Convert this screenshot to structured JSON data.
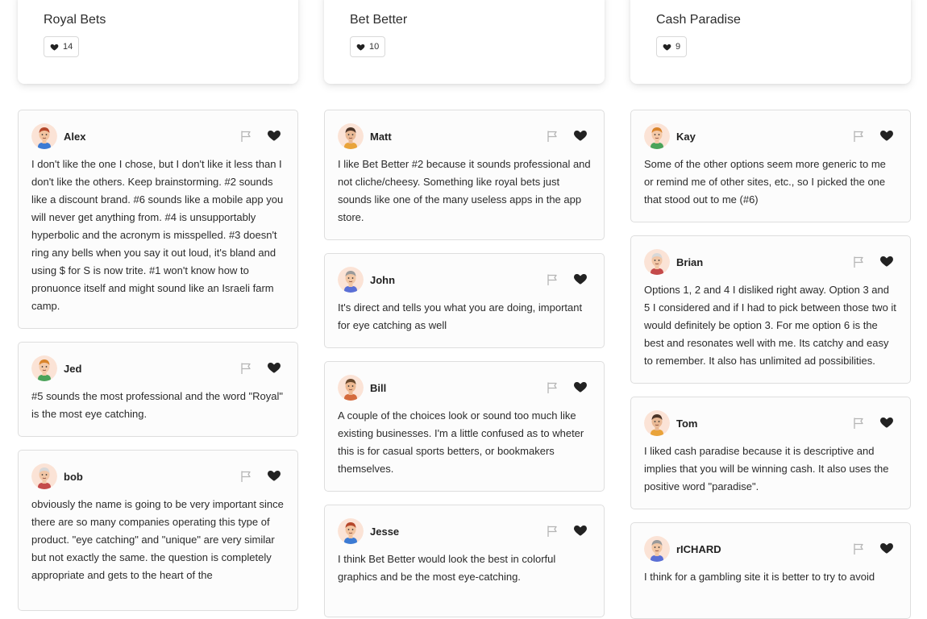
{
  "options": [
    {
      "name": "Royal Bets",
      "likes": "14"
    },
    {
      "name": "Bet Better",
      "likes": "10"
    },
    {
      "name": "Cash Paradise",
      "likes": "9"
    }
  ],
  "columns": [
    [
      {
        "user": "Alex",
        "text": "I don't like the one I chose, but I don't like it less than I don't like the others. Keep brainstorming. #2 sounds like a discount brand. #6 sounds like a mobile app you will never get anything from. #4 is unsupportably hyperbolic and the acronym is misspelled. #3 doesn't ring any bells when you say it out loud, it's bland and using $ for S is now trite. #1 won't know how to pronuonce itself and might sound like an Israeli farm camp."
      },
      {
        "user": "Jed",
        "text": "#5 sounds the most professional and the word \"Royal\" is the most eye catching."
      },
      {
        "user": "bob",
        "text": "obviously the name is going to be very important since there are so many companies operating this type of product. \"eye catching\" and \"unique\" are very similar but not exactly the same. the question is completely appropriate and gets to the heart of the"
      }
    ],
    [
      {
        "user": "Matt",
        "text": "I like Bet Better #2 because it sounds professional and not cliche/cheesy. Something like royal bets just sounds like one of the many useless apps in the app store."
      },
      {
        "user": "John",
        "text": "It's direct and tells you what you are doing, important for eye catching as well"
      },
      {
        "user": "Bill",
        "text": "A couple of the choices look or sound too much like existing businesses. I'm a little confused as to wheter this is for casual sports betters, or bookmakers themselves."
      },
      {
        "user": "Jesse",
        "text": "I think Bet Better would look the best in colorful graphics and be the most eye-catching."
      }
    ],
    [
      {
        "user": "Kay",
        "text": "Some of the other options seem more generic to me or remind me of other sites, etc., so I picked the one that stood out to me (#6)"
      },
      {
        "user": "Brian",
        "text": "Options 1, 2 and 4 I disliked right away. Option 3 and 5 I considered and if I had to pick between those two it would definitely be option 3. For me option 6 is the best and resonates well with me. Its catchy and easy to remember. It also has unlimited ad possibilities."
      },
      {
        "user": "Tom",
        "text": "I liked cash paradise because it is descriptive and implies that you will be winning cash. It also uses the positive word \"paradise\"."
      },
      {
        "user": "rICHARD",
        "text": "I think for a gambling site it is better to try to avoid"
      }
    ]
  ],
  "icons": {
    "like": "heart-icon",
    "flag": "flag-icon",
    "avatar": "avatar-icon"
  },
  "colors": {
    "heart": "#222222",
    "flag": "#bbbbbb",
    "card_border": "#dedede"
  }
}
